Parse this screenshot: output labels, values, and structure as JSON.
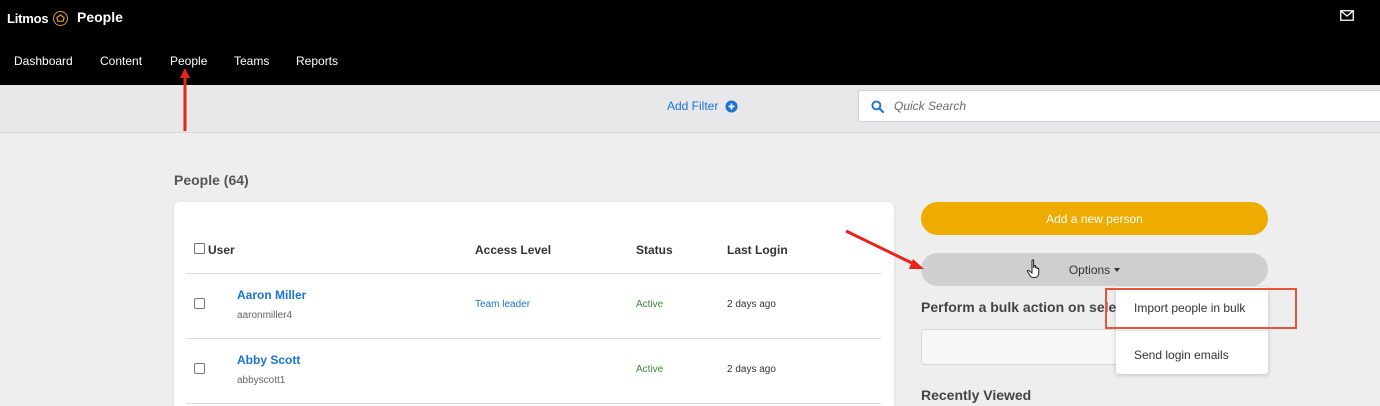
{
  "app": {
    "brand": "Litmos",
    "section_title": "People",
    "icons": {
      "brand_logo": "litmos-logo-icon",
      "mail": "envelope-icon"
    }
  },
  "nav": {
    "items": [
      {
        "label": "Dashboard"
      },
      {
        "label": "Content"
      },
      {
        "label": "People"
      },
      {
        "label": "Teams"
      },
      {
        "label": "Reports"
      }
    ],
    "active": "People"
  },
  "filter_bar": {
    "add_filter_label": "Add Filter",
    "search_placeholder": "Quick Search"
  },
  "people": {
    "heading": "People (64)",
    "columns": [
      "User",
      "Access Level",
      "Status",
      "Last Login"
    ],
    "rows": [
      {
        "name": "Aaron Miller",
        "username": "aaronmiller4",
        "access_level": "Team leader",
        "status": "Active",
        "last_login": "2 days ago"
      },
      {
        "name": "Abby Scott",
        "username": "abbyscott1",
        "access_level": "",
        "status": "Active",
        "last_login": "2 days ago"
      }
    ]
  },
  "sidebar": {
    "add_person_label": "Add a new person",
    "options_label": "Options",
    "bulk_action_title": "Perform a bulk action on selected",
    "recently_viewed_title": "Recently Viewed",
    "options_menu": [
      {
        "label": "Import people in bulk"
      },
      {
        "label": "Send login emails"
      }
    ]
  },
  "colors": {
    "topbar": "#000000",
    "link": "#1b73d2",
    "primary_button": "#efac00",
    "status_active": "#3a8a3a",
    "annotation": "#e8241a"
  }
}
